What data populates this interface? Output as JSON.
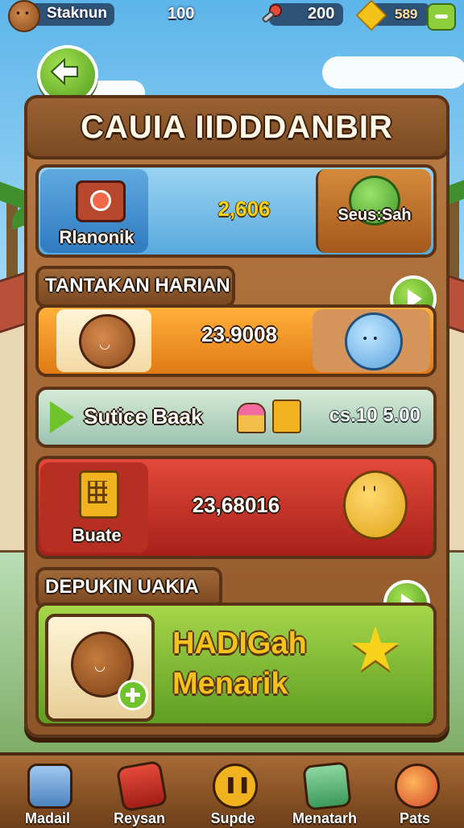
{
  "topbar": {
    "player_name": "Staknun",
    "coins": "100",
    "keys": "200",
    "gems": "589"
  },
  "panel": {
    "title": "CAUIA IIDDDANBIR"
  },
  "row1": {
    "left_label": "Rlanonik",
    "value": "2,606",
    "right_label": "Seus:Sah"
  },
  "section1": {
    "label": "TANTAKAN HARIAN"
  },
  "row2": {
    "value": "23.9008"
  },
  "row3": {
    "label": "Sutice Baak",
    "value": "cs.10 5.00"
  },
  "row4": {
    "label": "Buate",
    "value": "23,68016"
  },
  "section2": {
    "label": "DEPUKIN UAKIA"
  },
  "row5": {
    "title_line1": "HADIGah",
    "title_line2": "Menarik"
  },
  "bottom_nav": {
    "items": [
      {
        "label": "Madail",
        "icon": "map-icon"
      },
      {
        "label": "Reysan",
        "icon": "gift-icon"
      },
      {
        "label": "Supde",
        "icon": "pause-icon"
      },
      {
        "label": "Menatarh",
        "icon": "pencil-icon"
      },
      {
        "label": "Pats",
        "icon": "pet-icon"
      }
    ]
  },
  "colors": {
    "accent_green": "#6fc42b",
    "wood": "#8d5529",
    "gold": "#f3c21b",
    "red_row": "#c8302a",
    "blue_row": "#57a9dd",
    "orange_row": "#f09020"
  }
}
